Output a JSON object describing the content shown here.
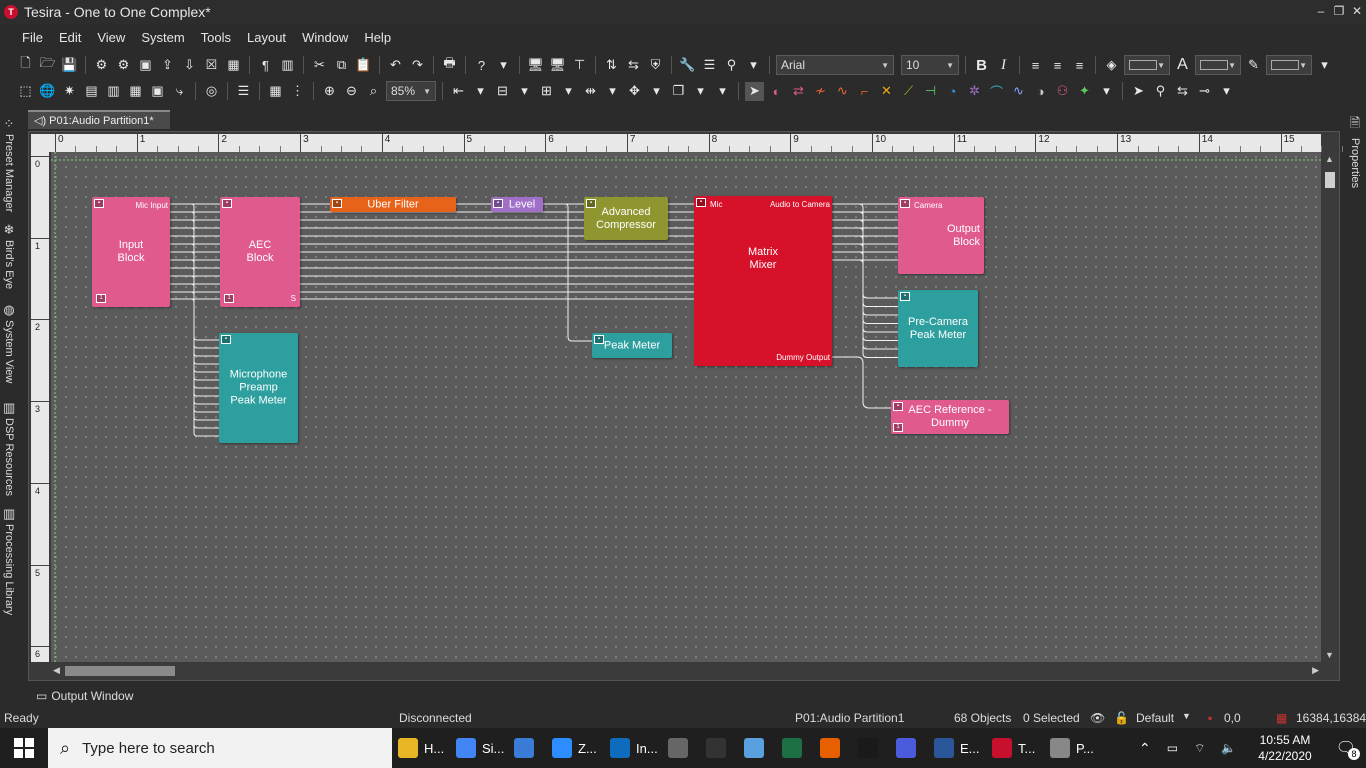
{
  "window": {
    "title": "Tesira - One to One Complex*",
    "logo_letter": "T",
    "minimize": "‒",
    "restore": "❐",
    "close": "✕"
  },
  "menu": [
    "File",
    "Edit",
    "View",
    "System",
    "Tools",
    "Layout",
    "Window",
    "Help"
  ],
  "toolbar": {
    "font_name": "Arial",
    "font_size": "10",
    "zoom": "85%",
    "bold": "B",
    "italic": "I",
    "text_a": "A"
  },
  "document_tab": {
    "label": "P01:Audio Partition1*",
    "icon": "audio-icon"
  },
  "left_panels": [
    "Preset Manager",
    "Bird's Eye",
    "System View",
    "DSP Resources",
    "Processing Library"
  ],
  "right_panels": [
    "Properties"
  ],
  "ruler": {
    "ticks": [
      "0",
      "1",
      "2",
      "3",
      "4",
      "5",
      "6",
      "7",
      "8",
      "9",
      "10",
      "11",
      "12",
      "13",
      "14",
      "15"
    ],
    "vticks": [
      "0",
      "1",
      "2",
      "3",
      "4",
      "5",
      "6"
    ]
  },
  "blocks": [
    {
      "key": "input",
      "name": "Input\nBlock",
      "port_label": "Mic Input",
      "badge": "1",
      "color": "#e05a8d"
    },
    {
      "key": "aec",
      "name": "AEC\nBlock",
      "badge": "1",
      "corner": "S",
      "color": "#e05a8d"
    },
    {
      "key": "uber",
      "name": "Uber Filter",
      "badge": "",
      "color": "#e8631a"
    },
    {
      "key": "level",
      "name": "Level",
      "badge": "",
      "color": "#a070c8"
    },
    {
      "key": "compressor",
      "name": "Advanced\nCompressor",
      "badge": "",
      "color": "#8f962f"
    },
    {
      "key": "matrix",
      "name": "Matrix\nMixer",
      "port_in": "Mic",
      "port_out": "Audio to Camera",
      "port_dummy": "Dummy Output",
      "color": "#d8112b"
    },
    {
      "key": "output",
      "name": "Output\nBlock",
      "port_label": "Camera",
      "color": "#e05a8d"
    },
    {
      "key": "mic_peak",
      "name": "Microphone\nPreamp\nPeak Meter",
      "color": "#2e9f9f"
    },
    {
      "key": "peak",
      "name": "Peak Meter",
      "color": "#2e9f9f"
    },
    {
      "key": "precam",
      "name": "Pre-Camera\nPeak Meter",
      "color": "#2e9f9f"
    },
    {
      "key": "aecref",
      "name": "AEC Reference -\nDummy",
      "badge": "1",
      "color": "#e05a8d"
    }
  ],
  "output_window": {
    "label": "Output Window"
  },
  "status": {
    "ready": "Ready",
    "connection": "Disconnected",
    "partition": "P01:Audio Partition1",
    "objects": "68 Objects",
    "selected": "0 Selected",
    "preset": "Default",
    "coord1": "0,0",
    "coord2": "16384,16384"
  },
  "taskbar": {
    "search_placeholder": "Type here to search",
    "apps": [
      {
        "label": "H...",
        "icon": "folder-icon",
        "color": "#e8b624"
      },
      {
        "label": "Si...",
        "icon": "chrome-icon",
        "color": "#4285f4"
      },
      {
        "label": "",
        "icon": "network-icon",
        "color": "#3a7bd5"
      },
      {
        "label": "Z...",
        "icon": "zoom-icon",
        "color": "#2d8cff"
      },
      {
        "label": "In...",
        "icon": "outlook-icon",
        "color": "#0f6cbd"
      },
      {
        "label": "",
        "icon": "device-icon",
        "color": "#666"
      },
      {
        "label": "",
        "icon": "terminal-icon",
        "color": "#333"
      },
      {
        "label": "",
        "icon": "tool-icon",
        "color": "#5aa0e0"
      },
      {
        "label": "",
        "icon": "excel-icon",
        "color": "#1d7044"
      },
      {
        "label": "",
        "icon": "firefox-icon",
        "color": "#e66000"
      },
      {
        "label": "",
        "icon": "ip-icon",
        "color": "#1a1a1a"
      },
      {
        "label": "",
        "icon": "media-icon",
        "color": "#4a5cdb"
      },
      {
        "label": "E...",
        "icon": "word-icon",
        "color": "#2b579a"
      },
      {
        "label": "T...",
        "icon": "tesira-icon",
        "color": "#c8102e"
      },
      {
        "label": "P...",
        "icon": "paint-icon",
        "color": "#888"
      }
    ],
    "time": "10:55 AM",
    "date": "4/22/2020",
    "notifications": "8"
  }
}
